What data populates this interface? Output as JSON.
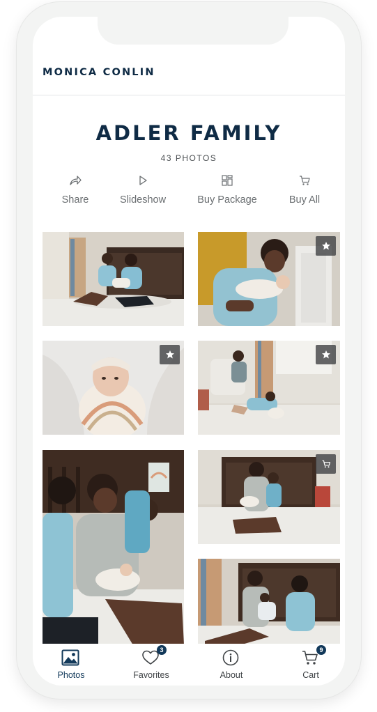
{
  "brand": {
    "name": "MONICA CONLIN"
  },
  "gallery": {
    "title": "ADLER FAMILY",
    "photo_count": "43 PHOTOS"
  },
  "actions": [
    {
      "label": "Share",
      "icon": "share-icon"
    },
    {
      "label": "Slideshow",
      "icon": "play-icon"
    },
    {
      "label": "Buy Package",
      "icon": "package-icon"
    },
    {
      "label": "Buy All",
      "icon": "cart-icon"
    }
  ],
  "photos": [
    {
      "subject": "family on floor",
      "badge": null
    },
    {
      "subject": "father kissing newborn",
      "badge": "star-icon"
    },
    {
      "subject": "swaddled newborn",
      "badge": "star-icon"
    },
    {
      "subject": "father and son playing on rug",
      "badge": "star-icon"
    },
    {
      "subject": "family on bed",
      "badge": null
    },
    {
      "subject": "father and son with baby",
      "badge": "cart-icon"
    },
    {
      "subject": "family on bed",
      "badge": null
    }
  ],
  "tabs": [
    {
      "label": "Photos",
      "icon": "image-icon",
      "active": true
    },
    {
      "label": "Favorites",
      "icon": "heart-icon",
      "count": "3"
    },
    {
      "label": "About",
      "icon": "info-icon"
    },
    {
      "label": "Cart",
      "icon": "cart-icon",
      "count": "9"
    }
  ],
  "colors": {
    "brand_navy": "#0f2b45",
    "badge_navy": "#12395a",
    "icon_gray": "#6a6e71"
  }
}
